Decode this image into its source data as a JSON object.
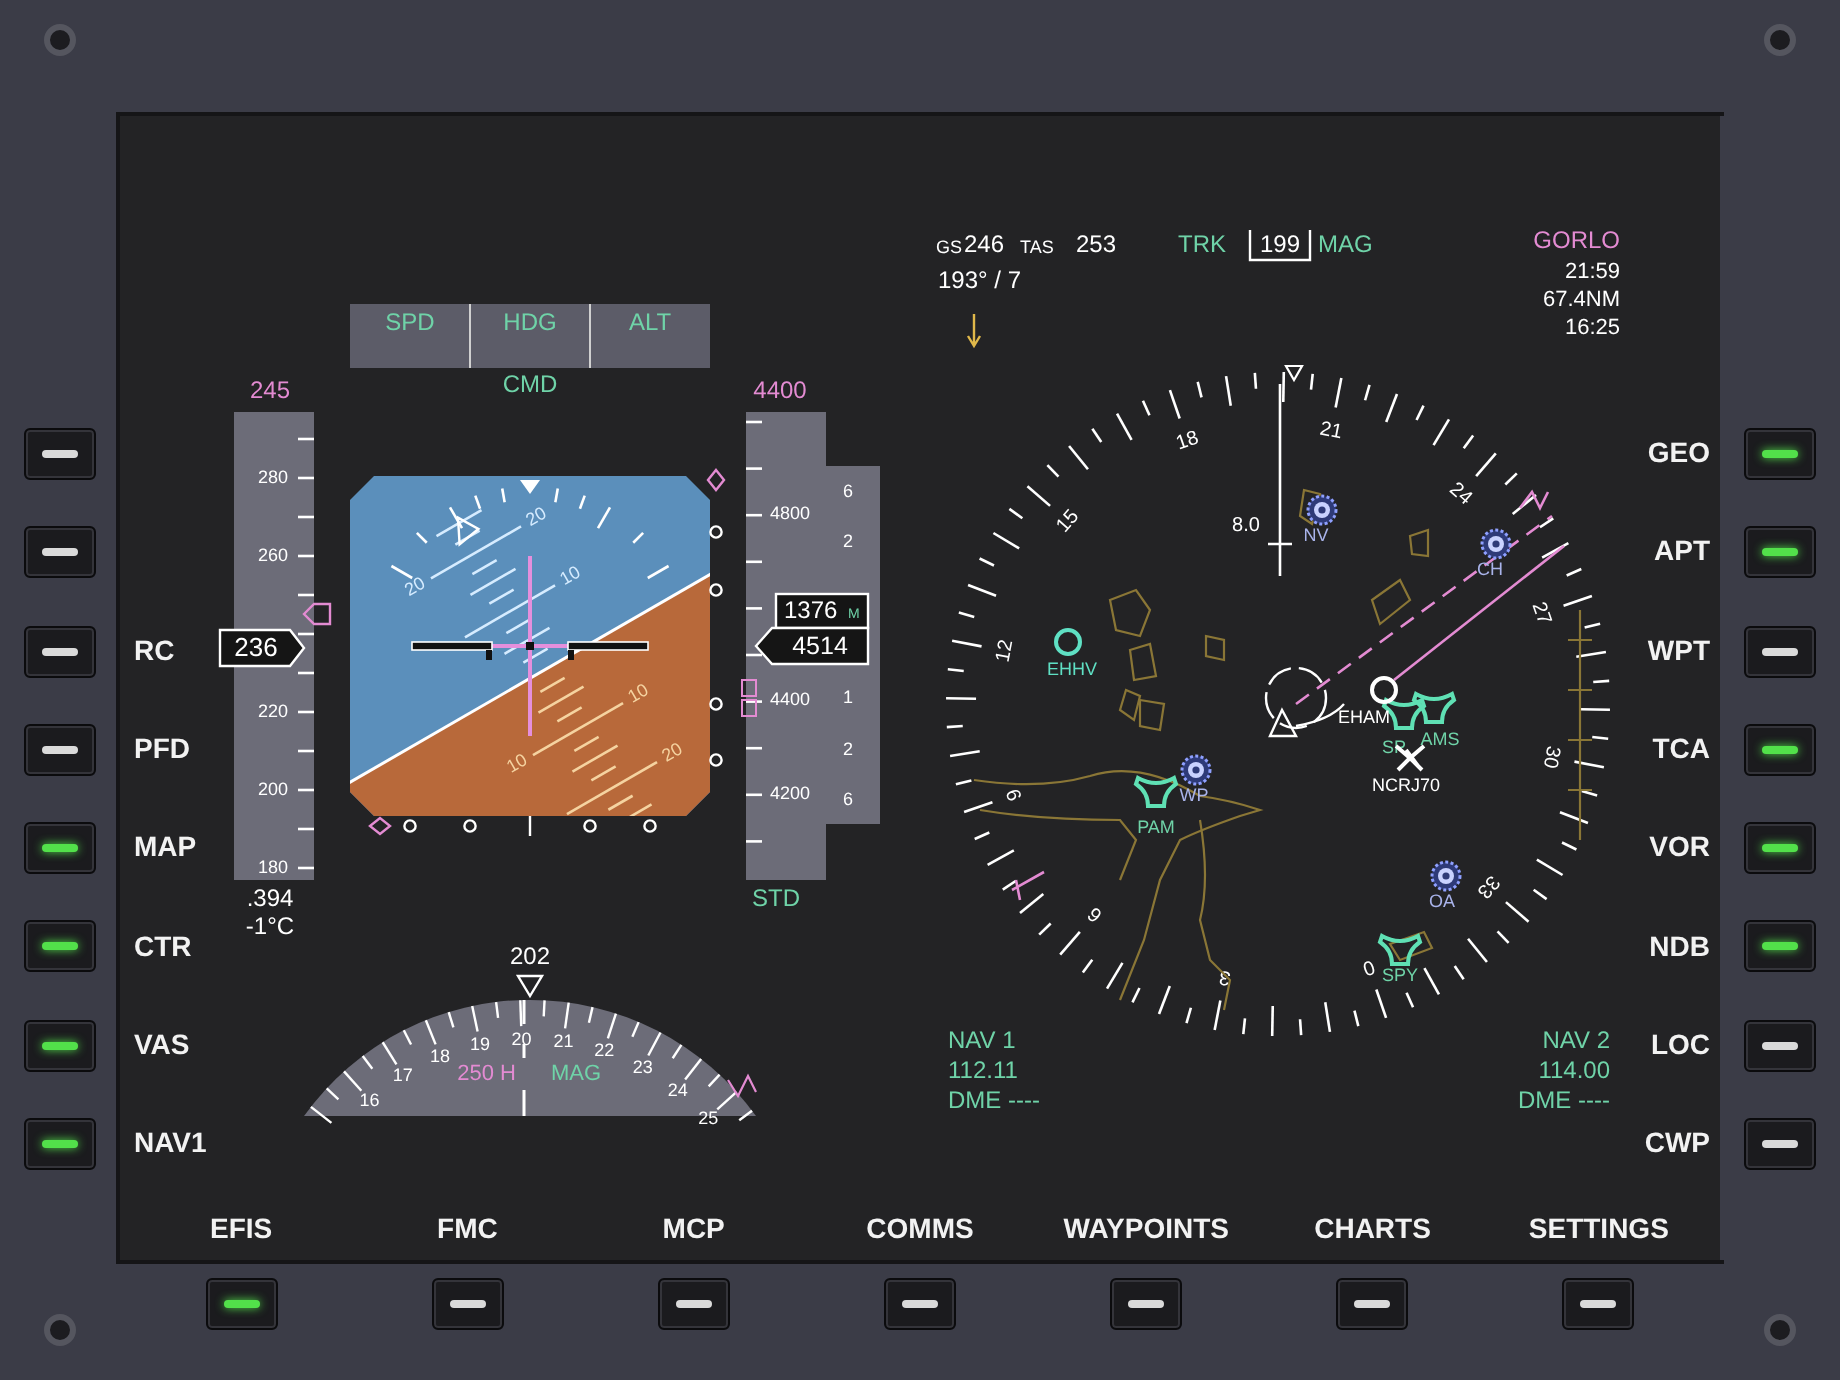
{
  "left_buttons": [
    {
      "on": false
    },
    {
      "on": false
    },
    {
      "label": "RC",
      "on": false
    },
    {
      "label": "PFD",
      "on": false
    },
    {
      "label": "MAP",
      "on": true
    },
    {
      "label": "CTR",
      "on": true
    },
    {
      "label": "VAS",
      "on": true
    },
    {
      "label": "NAV1",
      "on": true
    }
  ],
  "right_buttons": [
    {
      "label": "GEO",
      "on": true
    },
    {
      "label": "APT",
      "on": true
    },
    {
      "label": "WPT",
      "on": false
    },
    {
      "label": "TCA",
      "on": true
    },
    {
      "label": "VOR",
      "on": true
    },
    {
      "label": "NDB",
      "on": true
    },
    {
      "label": "LOC",
      "on": false
    },
    {
      "label": "CWP",
      "on": false
    }
  ],
  "bottom_buttons": [
    {
      "label": "EFIS",
      "on": true
    },
    {
      "label": "FMC",
      "on": false
    },
    {
      "label": "MCP",
      "on": false
    },
    {
      "label": "COMMS",
      "on": false
    },
    {
      "label": "WAYPOINTS",
      "on": false
    },
    {
      "label": "CHARTS",
      "on": false
    },
    {
      "label": "SETTINGS",
      "on": false
    }
  ],
  "pfd": {
    "modes": [
      "SPD",
      "HDG",
      "ALT"
    ],
    "mode_status": "CMD",
    "speed": {
      "selected": "245",
      "scale": [
        "280",
        "260",
        "220",
        "200",
        "180"
      ],
      "current": "236",
      "mach": ".394",
      "temperature": "-1°C"
    },
    "attitude": {
      "pitch_labels": [
        "20",
        "20",
        "10",
        "10",
        "10",
        "20"
      ]
    },
    "altitude": {
      "selected": "4400",
      "scale": [
        "4800",
        "4400",
        "4200"
      ],
      "vsi_scale": [
        "6",
        "2",
        "1",
        "2",
        "6"
      ],
      "radio": "1376",
      "radio_unit": "M",
      "current": "4514",
      "baro": "STD"
    },
    "heading": {
      "current": "202",
      "scale": [
        "16",
        "17",
        "18",
        "19",
        "20",
        "21",
        "22",
        "23",
        "24",
        "25"
      ],
      "selected": "250 H",
      "reference": "MAG"
    }
  },
  "nd": {
    "gs_label": "GS",
    "gs": "246",
    "tas_label": "TAS",
    "tas": "253",
    "wind": "193° / 7",
    "track_label": "TRK",
    "track": "199",
    "track_ref": "MAG",
    "waypoint": "GORLO",
    "eta": "21:59",
    "distance": "67.4NM",
    "ete": "16:25",
    "compass_labels": [
      "0",
      "3",
      "6",
      "9",
      "12",
      "15",
      "18",
      "21",
      "24",
      "27",
      "30",
      "33"
    ],
    "range": "8.0",
    "stations": [
      {
        "name": "NV",
        "kind": "vor"
      },
      {
        "name": "CH",
        "kind": "vor"
      },
      {
        "name": "WP",
        "kind": "vor"
      },
      {
        "name": "OA",
        "kind": "vor"
      },
      {
        "name": "EHHV",
        "kind": "airport"
      },
      {
        "name": "PAM",
        "kind": "vortac"
      },
      {
        "name": "SP",
        "kind": "vortac"
      },
      {
        "name": "AMS",
        "kind": "vortac"
      },
      {
        "name": "SPY",
        "kind": "vortac"
      },
      {
        "name": "EHAM",
        "kind": "origin"
      },
      {
        "name": "NCRJ70",
        "kind": "traffic"
      }
    ],
    "nav1": {
      "label": "NAV 1",
      "frequency": "112.11",
      "dme": "DME ----"
    },
    "nav2": {
      "label": "NAV 2",
      "frequency": "114.00",
      "dme": "DME ----"
    }
  }
}
